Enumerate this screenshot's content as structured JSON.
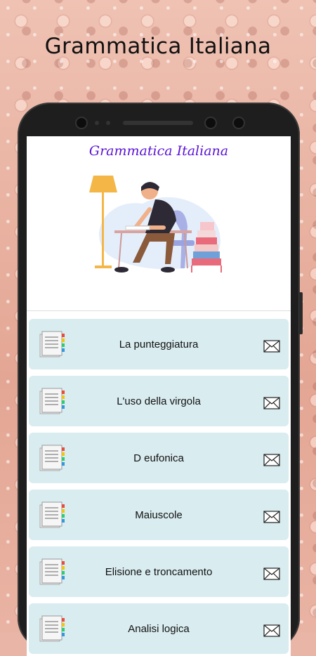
{
  "store_title": "Grammatica Italiana",
  "app": {
    "title": "Grammatica Italiana"
  },
  "items": [
    {
      "label": "La punteggiatura"
    },
    {
      "label": "L'uso della virgola"
    },
    {
      "label": "D eufonica"
    },
    {
      "label": "Maiuscole"
    },
    {
      "label": "Elisione e troncamento"
    },
    {
      "label": "Analisi logica"
    }
  ],
  "colors": {
    "title": "#5a12d6",
    "card": "#d9ecf0",
    "background": "#e8b5a6"
  }
}
